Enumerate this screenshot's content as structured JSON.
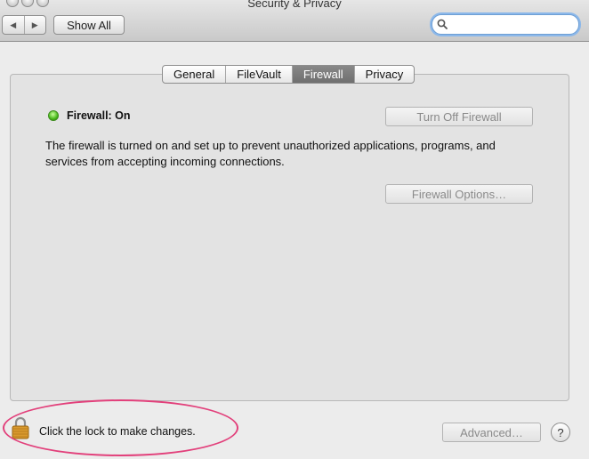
{
  "window": {
    "title": "Security & Privacy"
  },
  "toolbar": {
    "back_glyph": "◀",
    "forward_glyph": "▶",
    "show_all_label": "Show All",
    "search_value": ""
  },
  "tabs": [
    {
      "label": "General",
      "active": false
    },
    {
      "label": "FileVault",
      "active": false
    },
    {
      "label": "Firewall",
      "active": true
    },
    {
      "label": "Privacy",
      "active": false
    }
  ],
  "firewall": {
    "status_label": "Firewall: On",
    "status_color": "#48b81a",
    "turn_off_label": "Turn Off Firewall",
    "description": "The firewall is turned on and set up to prevent unauthorized applications, programs, and services from accepting incoming connections.",
    "options_label": "Firewall Options…"
  },
  "footer": {
    "lock_text": "Click the lock to make changes.",
    "advanced_label": "Advanced…",
    "help_label": "?",
    "highlight_color": "#e2407b"
  },
  "icons": {
    "traffic_lights": "traffic-light-icon",
    "search": "search-icon",
    "lock": "lock-icon",
    "status": "status-light-icon"
  }
}
